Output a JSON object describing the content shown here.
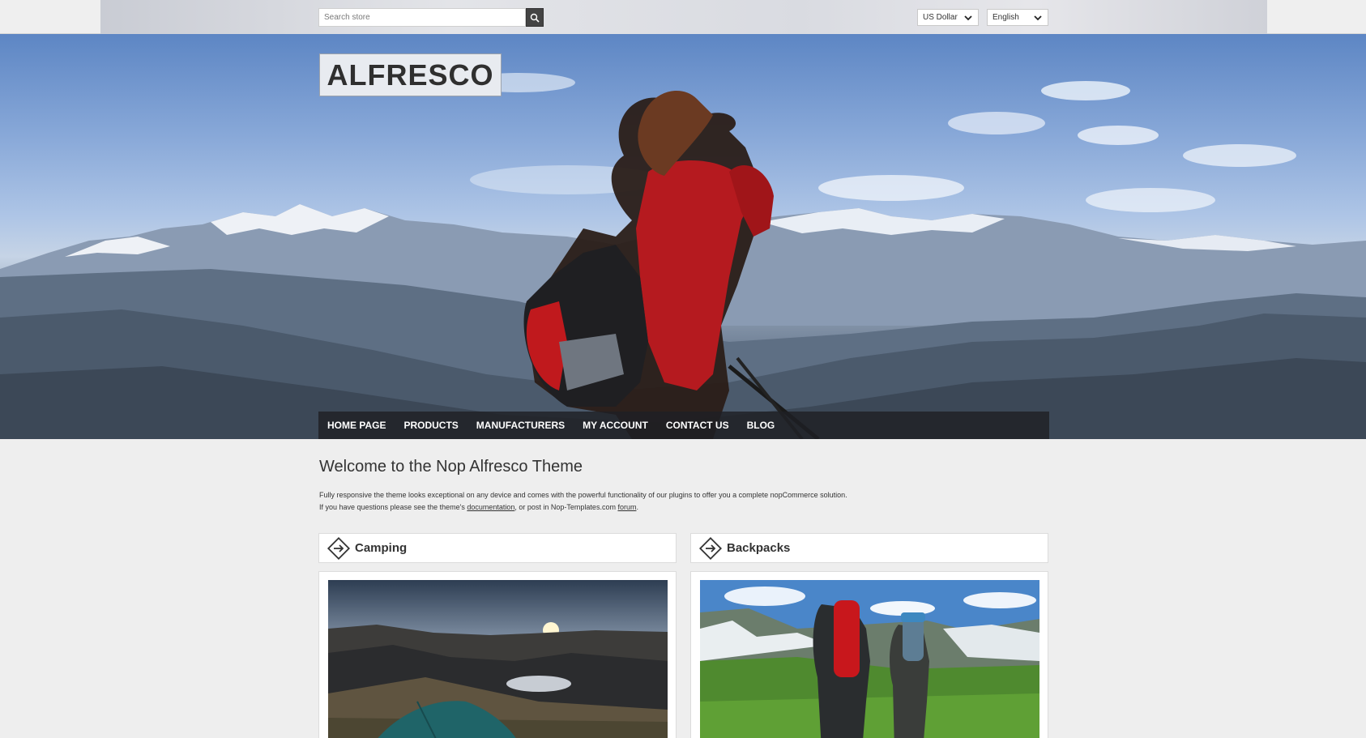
{
  "topbar": {
    "search_placeholder": "Search store",
    "search_icon": "search-icon",
    "currency": "US Dollar",
    "language": "English"
  },
  "hero": {
    "logo": "ALFRESCO"
  },
  "nav": {
    "items": [
      "HOME PAGE",
      "PRODUCTS",
      "MANUFACTURERS",
      "MY ACCOUNT",
      "CONTACT US",
      "BLOG"
    ]
  },
  "welcome": {
    "title": "Welcome to the Nop Alfresco Theme",
    "line1": "Fully responsive the theme looks exceptional on any device and comes with the powerful functionality of our plugins to offer you a complete nopCommerce solution.",
    "line2_prefix": "If you have questions please see the theme's ",
    "link_documentation": "documentation",
    "line2_middle": ", or post in Nop-Templates.com ",
    "link_forum": "forum",
    "line2_suffix": "."
  },
  "categories": [
    {
      "name": "Camping",
      "icon": "arrow-diamond-icon"
    },
    {
      "name": "Backpacks",
      "icon": "arrow-diamond-icon"
    }
  ],
  "colors": {
    "nav_bg": "#1e2024",
    "page_bg": "#eeeeee",
    "search_button": "#444444"
  }
}
